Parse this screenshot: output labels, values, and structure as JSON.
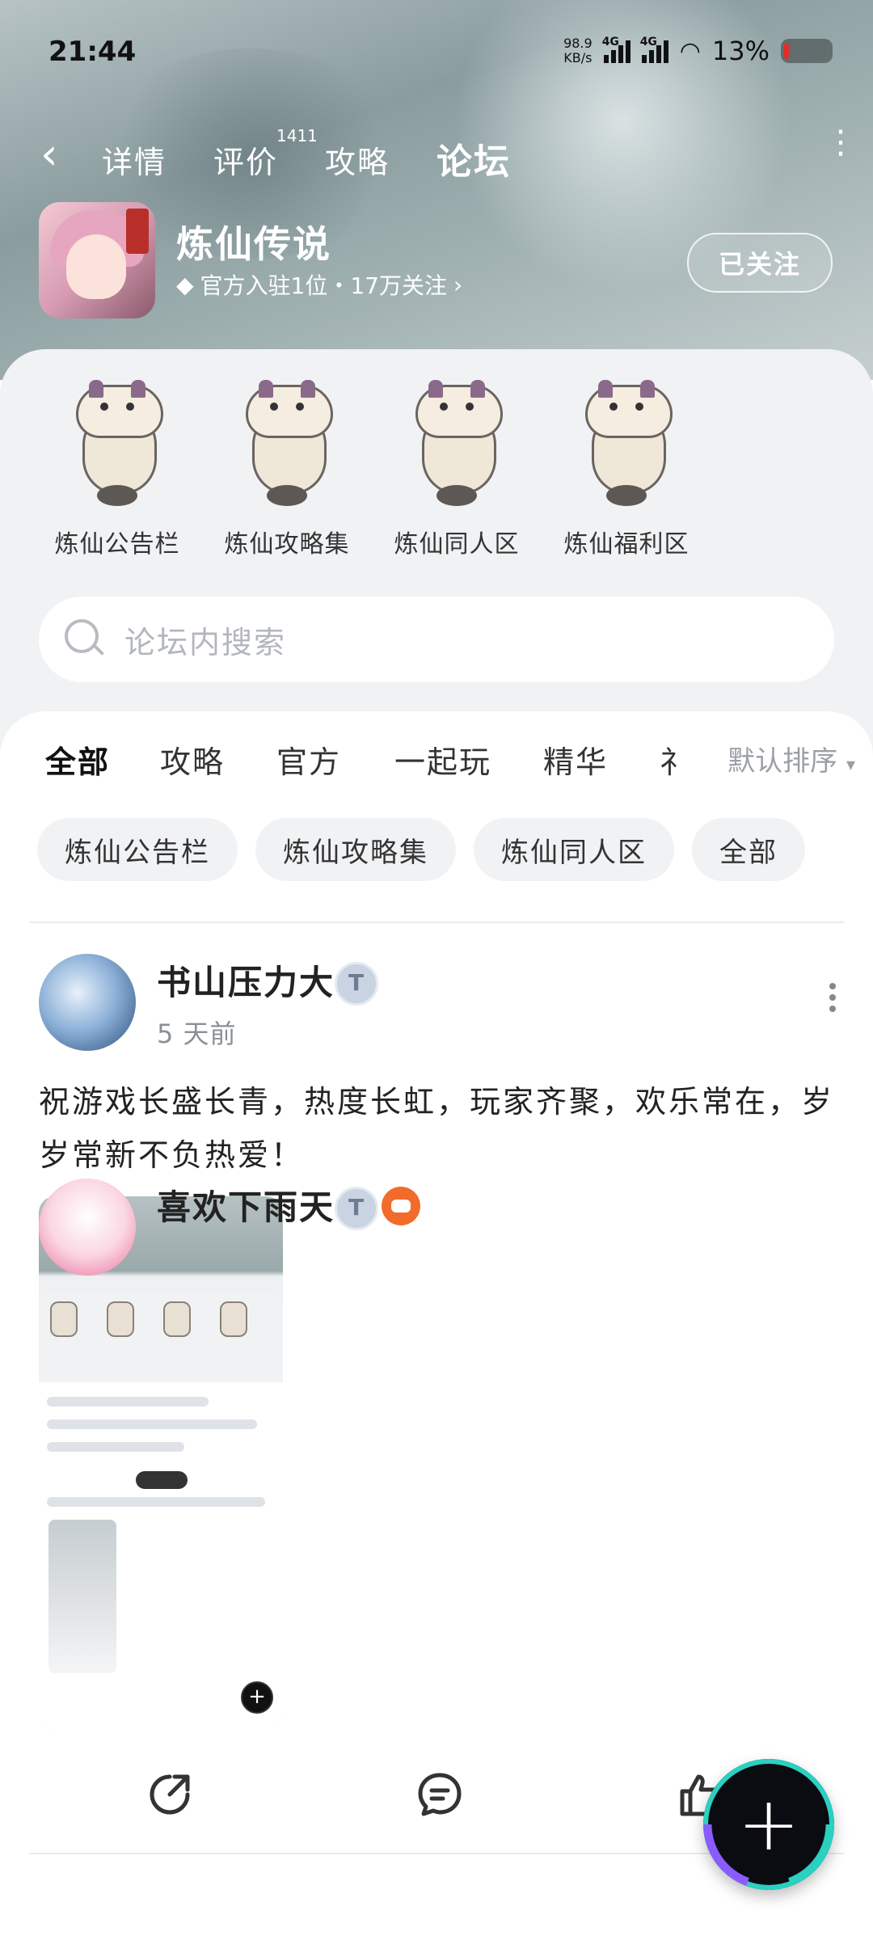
{
  "status": {
    "time": "21:44",
    "net_speed_value": "98.9",
    "net_speed_unit": "KB/s",
    "sig1": "4G",
    "sig2": "4G",
    "battery": "13%"
  },
  "nav": {
    "tabs": [
      {
        "label": "详情"
      },
      {
        "label": "评价",
        "badge": "1411"
      },
      {
        "label": "攻略"
      },
      {
        "label": "论坛"
      }
    ],
    "active_tab": "论坛"
  },
  "game": {
    "title": "炼仙传说",
    "meta": "官方入驻1位・17万关注",
    "follow_label": "已关注"
  },
  "boards": [
    {
      "label": "炼仙公告栏"
    },
    {
      "label": "炼仙攻略集"
    },
    {
      "label": "炼仙同人区"
    },
    {
      "label": "炼仙福利区"
    }
  ],
  "search": {
    "placeholder": "论坛内搜索"
  },
  "filter_tabs": [
    {
      "label": "全部"
    },
    {
      "label": "攻略"
    },
    {
      "label": "官方"
    },
    {
      "label": "一起玩"
    },
    {
      "label": "精华"
    },
    {
      "label": "礻"
    }
  ],
  "sort_label": "默认排序",
  "chips": [
    {
      "label": "炼仙公告栏"
    },
    {
      "label": "炼仙攻略集"
    },
    {
      "label": "炼仙同人区"
    },
    {
      "label": "全部"
    }
  ],
  "post1": {
    "user": "书山压力大",
    "time": "5 天前",
    "text": "祝游戏长盛长青，热度长虹，玩家齐聚，欢乐常在，岁岁常新不负热爱！"
  },
  "post2": {
    "user": "喜欢下雨天"
  },
  "colors": {
    "accent": "#17c3b2",
    "fab": "#0b0b12"
  }
}
